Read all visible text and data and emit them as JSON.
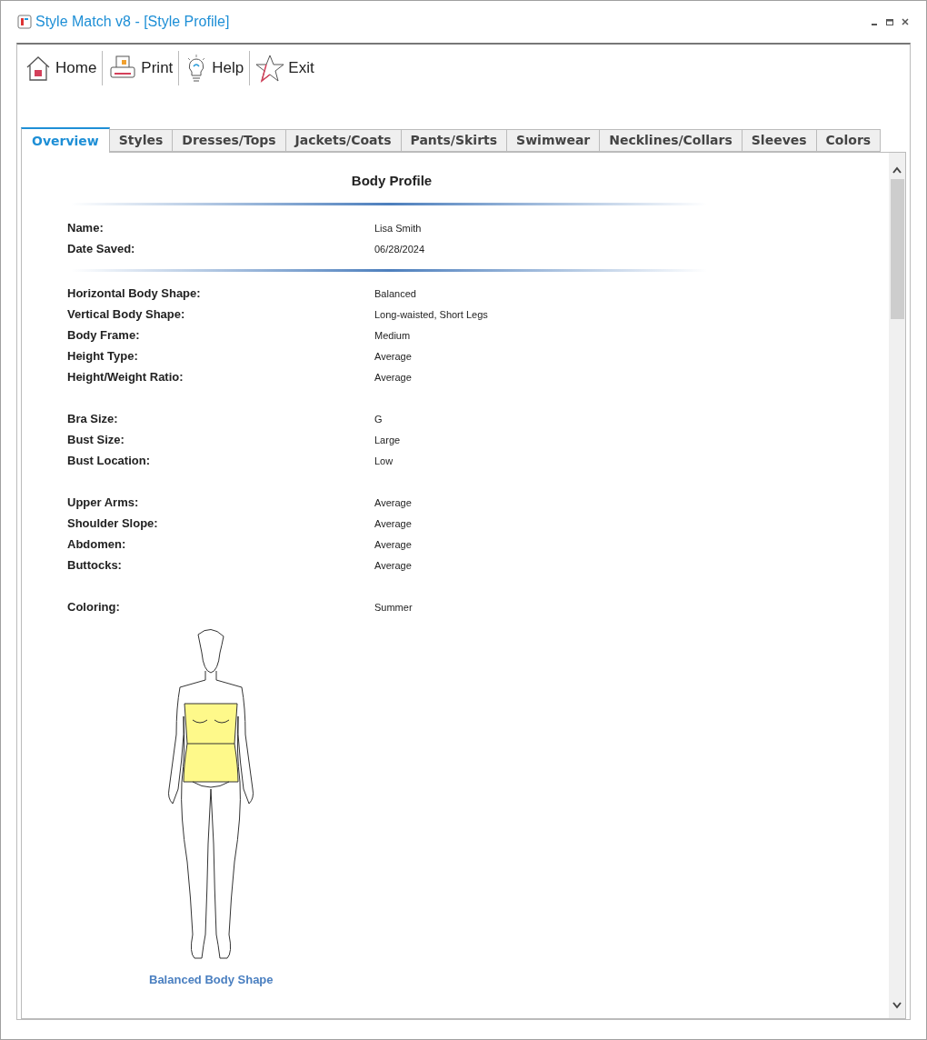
{
  "window": {
    "title": "Style Match v8 - [Style Profile]"
  },
  "toolbar": [
    {
      "kind": "home",
      "label": "Home"
    },
    {
      "kind": "print",
      "label": "Print"
    },
    {
      "kind": "help",
      "label": "Help"
    },
    {
      "kind": "exit",
      "label": "Exit"
    }
  ],
  "tabs": [
    {
      "label": "Overview",
      "selected": true
    },
    {
      "label": "Styles",
      "selected": false
    },
    {
      "label": "Dresses/Tops",
      "selected": false
    },
    {
      "label": "Jackets/Coats",
      "selected": false
    },
    {
      "label": "Pants/Skirts",
      "selected": false
    },
    {
      "label": "Swimwear",
      "selected": false
    },
    {
      "label": "Necklines/Collars",
      "selected": false
    },
    {
      "label": "Sleeves",
      "selected": false
    },
    {
      "label": "Colors",
      "selected": false
    }
  ],
  "profile": {
    "title": "Body Profile",
    "header_fields": [
      {
        "label": "Name:",
        "value": "Lisa Smith"
      },
      {
        "label": "Date Saved:",
        "value": "06/28/2024"
      }
    ],
    "groups": [
      [
        {
          "label": "Horizontal Body Shape:",
          "value": "Balanced"
        },
        {
          "label": "Vertical Body Shape:",
          "value": "Long-waisted, Short Legs"
        },
        {
          "label": "Body Frame:",
          "value": "Medium"
        },
        {
          "label": "Height Type:",
          "value": "Average"
        },
        {
          "label": "Height/Weight Ratio:",
          "value": "Average"
        }
      ],
      [
        {
          "label": "Bra Size:",
          "value": "G"
        },
        {
          "label": "Bust Size:",
          "value": "Large"
        },
        {
          "label": "Bust Location:",
          "value": "Low"
        }
      ],
      [
        {
          "label": "Upper Arms:",
          "value": "Average"
        },
        {
          "label": "Shoulder Slope:",
          "value": "Average"
        },
        {
          "label": "Abdomen:",
          "value": "Average"
        },
        {
          "label": "Buttocks:",
          "value": "Average"
        }
      ],
      [
        {
          "label": "Coloring:",
          "value": "Summer"
        }
      ]
    ],
    "figure_caption": "Balanced Body Shape"
  }
}
